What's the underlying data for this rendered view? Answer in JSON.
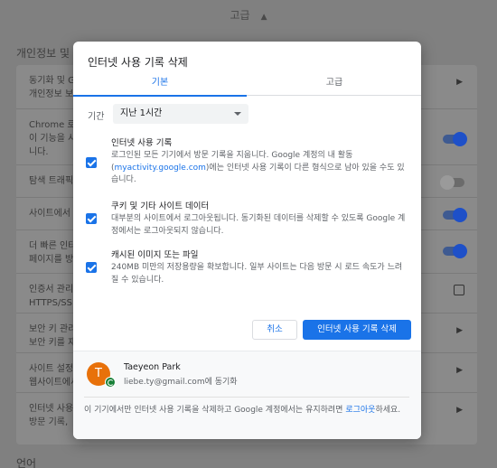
{
  "background": {
    "header_label": "고급",
    "section_title": "개인정보 및 보",
    "rows": [
      {
        "line1": "동기화 및 G",
        "line2": "개인정보 보"
      },
      {
        "line1": "Chrome 로",
        "line2": "이 기능을 사",
        "line3": "니다."
      },
      {
        "line1": "탐색 트래픽"
      },
      {
        "line1": "사이트에서"
      },
      {
        "line1": "더 빠른 인터",
        "line2": "페이지를 방"
      },
      {
        "line1": "인증서 관리",
        "line2": "HTTPS/SSL"
      },
      {
        "line1": "보안 키 관리",
        "line2": "보안 키를 재"
      },
      {
        "line1": "사이트 설정",
        "line2": "웹사이트에서"
      },
      {
        "line1": "인터넷 사용",
        "line2": "방문 기록,"
      }
    ],
    "language_label": "언어"
  },
  "dialog": {
    "title": "인터넷 사용 기록 삭제",
    "tabs": [
      {
        "label": "기본",
        "active": true
      },
      {
        "label": "고급",
        "active": false
      }
    ],
    "period": {
      "label": "기간",
      "selected": "지난 1시간"
    },
    "options": [
      {
        "title": "인터넷 사용 기록",
        "desc_before": "로그인된 모든 기기에서 방문 기록을 지웁니다. Google 계정의 내 활동 (",
        "desc_link": "myactivity.google.com",
        "desc_after": ")에는 인터넷 사용 기록이 다른 형식으로 남아 있을 수도 있습니다.",
        "checked": true
      },
      {
        "title": "쿠키 및 기타 사이트 데이터",
        "desc": "대부분의 사이트에서 로그아웃됩니다. 동기화된 데이터를 삭제할 수 있도록 Google 계정에서는 로그아웃되지 않습니다.",
        "checked": true
      },
      {
        "title": "캐시된 이미지 또는 파일",
        "desc": "240MB 미만의 저장용량을 확보합니다. 일부 사이트는 다음 방문 시 로드 속도가 느려질 수 있습니다.",
        "checked": true
      }
    ],
    "cancel_label": "취소",
    "delete_label": "인터넷 사용 기록 삭제",
    "account": {
      "avatar_letter": "T",
      "name": "Taeyeon Park",
      "email": "liebe.ty@gmail.com에 동기화"
    },
    "footer_before": "이 기기에서만 인터넷 사용 기록을 삭제하고 Google 계정에서는 유지하려면 ",
    "footer_link": "로그아웃",
    "footer_after": "하세요."
  }
}
